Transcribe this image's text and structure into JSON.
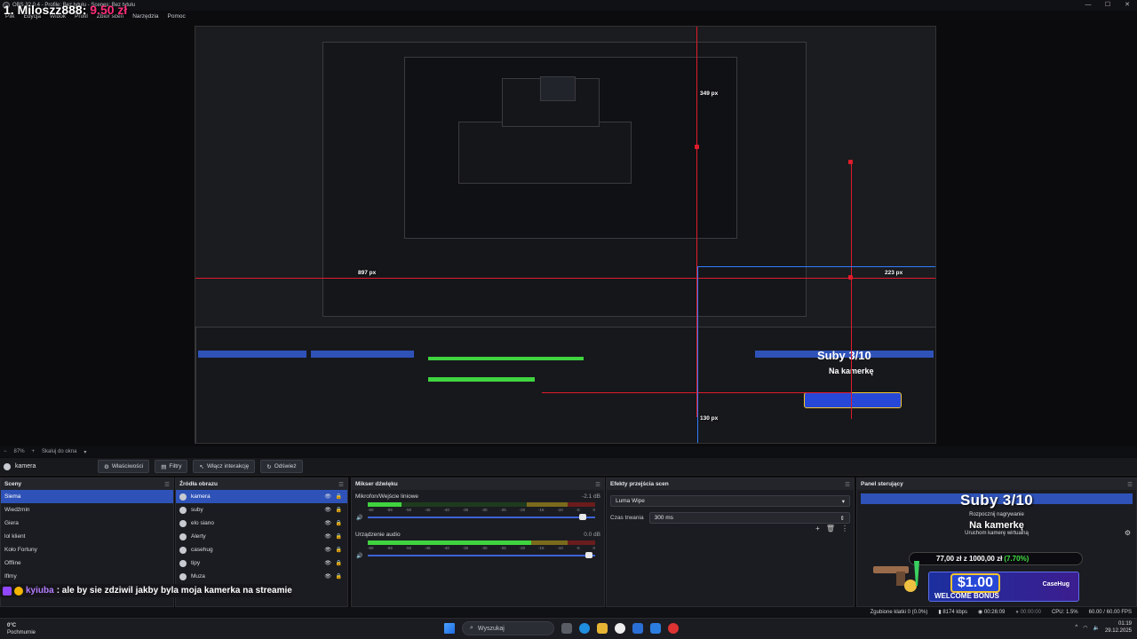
{
  "window": {
    "title": "OBS 32.0.4 - Profile: Bez tytułu - Scenes: Bez tytułu",
    "controls": [
      "—",
      "☐",
      "✕"
    ]
  },
  "menu": [
    "Plik",
    "Edycja",
    "Widok",
    "Profil",
    "Zbiór scen",
    "Narzędzia",
    "Pomoc"
  ],
  "donor": {
    "name": "1. Miloszz888:",
    "amount": "9.50 zł"
  },
  "preview": {
    "measure_top": "349 px",
    "measure_left": "897 px",
    "measure_right": "223 px",
    "measure_bottom": "130 px",
    "nested_title": "Suby 3/10",
    "nested_sub": "Na kamerkę"
  },
  "preview_bar": {
    "zoom": "87%",
    "scale_mode": "Skaluj do okna"
  },
  "source_bar": {
    "source_name": "kamera",
    "buttons": [
      "Właściwości",
      "Filtry",
      "Włącz interakcję",
      "Odśwież"
    ]
  },
  "scenes": {
    "title": "Sceny",
    "items": [
      "Siema",
      "Wiedźmin",
      "Giera",
      "lol klient",
      "Koło Fortuny",
      "Offline",
      "Iflmy"
    ],
    "selected": 0
  },
  "sources": {
    "title": "Źródła obrazu",
    "items": [
      "kamera",
      "suby",
      "elo siano",
      "Alerty",
      "casehug",
      "tipy",
      "Muza"
    ],
    "selected": 0
  },
  "mixer": {
    "title": "Mikser dźwięku",
    "channels": [
      {
        "name": "Mikrofon/Wejście liniowe",
        "db": "-2.1 dB",
        "level": 0.15,
        "volume": 0.96
      },
      {
        "name": "Urządzenie audio",
        "db": "0.0 dB",
        "level": 0.72,
        "volume": 0.99
      }
    ],
    "ticks": [
      "-60",
      "-55",
      "-50",
      "-45",
      "-40",
      "-35",
      "-30",
      "-25",
      "-20",
      "-15",
      "-10",
      "-5",
      "0"
    ]
  },
  "transitions": {
    "title": "Efekty przejścia scen",
    "selected": "Luma Wipe",
    "duration_label": "Czas trwania",
    "duration_value": "300 ms"
  },
  "control_panel": {
    "title": "Panel sterujący",
    "subs": "Suby 3/10",
    "start_recording": "Rozpocznij nagrywanie",
    "camera_text": "Na kamerkę",
    "virtual_camera": "Uruchom kamerę wirtualną",
    "goal_current": "77,00 zł",
    "goal_of": "z",
    "goal_target": "1000,00 zł",
    "goal_pct": "(7.70%)",
    "banner_value": "$1.00",
    "banner_text": "WELCOME BONUS",
    "banner_brand": "CaseHug"
  },
  "chat": {
    "user": "kyiuba",
    "message": ": ale by sie zdziwil jakby byla moja kamerka na streamie"
  },
  "status": {
    "dropped": "Zgubione klatki 0 (0.0%)",
    "bitrate": "8174 kbps",
    "live_time": "00:26:09",
    "rec_time": "00:00:00",
    "cpu": "CPU: 1.5%",
    "fps": "60.00 / 60.00 FPS"
  },
  "taskbar": {
    "temp": "0°C",
    "weather": "Pochmurnie",
    "search_placeholder": "Wyszukaj",
    "time": "01:19",
    "date": "29.12.2025"
  },
  "colors": {
    "accent": "#2e52b8",
    "red_guides": "#e01b2b",
    "blue_guides": "#2f7dff",
    "meter_green": "#3fd43f",
    "donation": "#ff2d7a"
  }
}
